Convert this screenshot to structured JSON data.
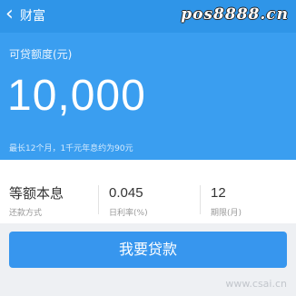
{
  "nav": {
    "back_icon": "chevron-left-icon",
    "title": "财富"
  },
  "watermark_top": "pos8888.cn",
  "loan": {
    "limit_label": "可贷额度(元)",
    "limit_amount": "10,000",
    "note": "最长12个月，1千元年息约为90元"
  },
  "terms": [
    {
      "value": "等额本息",
      "label": "还款方式"
    },
    {
      "value": "0.045",
      "label": "日利率(%)"
    },
    {
      "value": "12",
      "label": "期限(月)"
    }
  ],
  "apply_button": "我要贷款",
  "watermark_bottom": "www.csai.cn",
  "colors": {
    "primary": "#3a9ef0",
    "nav": "#2f95e8",
    "button": "#3796ee"
  }
}
